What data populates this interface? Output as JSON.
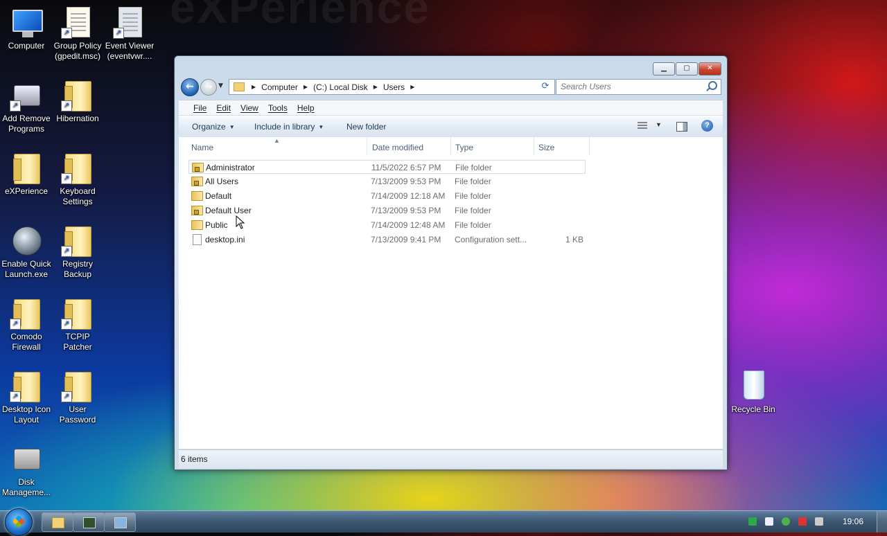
{
  "desktop": {
    "icons": [
      {
        "label": "Computer"
      },
      {
        "label": "Group Policy (gpedit.msc)"
      },
      {
        "label": "Event Viewer (eventvwr...."
      },
      {
        "label": "Add Remove Programs"
      },
      {
        "label": "Hibernation"
      },
      {
        "label": "eXPerience"
      },
      {
        "label": "Keyboard Settings"
      },
      {
        "label": "Enable Quick Launch.exe"
      },
      {
        "label": "Registry Backup"
      },
      {
        "label": "Comodo Firewall"
      },
      {
        "label": "TCPIP Patcher"
      },
      {
        "label": "Desktop Icon Layout"
      },
      {
        "label": "User Password"
      },
      {
        "label": "Disk Manageme..."
      },
      {
        "label": "Recycle Bin"
      }
    ]
  },
  "explorer": {
    "address": {
      "crumbs": [
        "Computer",
        "(C:) Local Disk",
        "Users"
      ]
    },
    "search": {
      "placeholder": "Search Users"
    },
    "menu": [
      "File",
      "Edit",
      "View",
      "Tools",
      "Help"
    ],
    "commands": {
      "organize": "Organize",
      "include": "Include in library",
      "new_folder": "New folder"
    },
    "columns": {
      "name": "Name",
      "date": "Date modified",
      "type": "Type",
      "size": "Size"
    },
    "files": [
      {
        "name": "Administrator",
        "date": "11/5/2022 6:57 PM",
        "type": "File folder",
        "size": "",
        "kind": "folder-locked"
      },
      {
        "name": "All Users",
        "date": "7/13/2009 9:53 PM",
        "type": "File folder",
        "size": "",
        "kind": "folder-locked"
      },
      {
        "name": "Default",
        "date": "7/14/2009 12:18 AM",
        "type": "File folder",
        "size": "",
        "kind": "folder"
      },
      {
        "name": "Default User",
        "date": "7/13/2009 9:53 PM",
        "type": "File folder",
        "size": "",
        "kind": "folder-locked"
      },
      {
        "name": "Public",
        "date": "7/14/2009 12:48 AM",
        "type": "File folder",
        "size": "",
        "kind": "folder"
      },
      {
        "name": "desktop.ini",
        "date": "7/13/2009 9:41 PM",
        "type": "Configuration sett...",
        "size": "1 KB",
        "kind": "file"
      }
    ],
    "status": "6 items"
  },
  "taskbar": {
    "clock": "19:06"
  },
  "colors": {
    "accent": "#1d70c8",
    "close": "#c8452f",
    "folder": "#f1d178"
  }
}
